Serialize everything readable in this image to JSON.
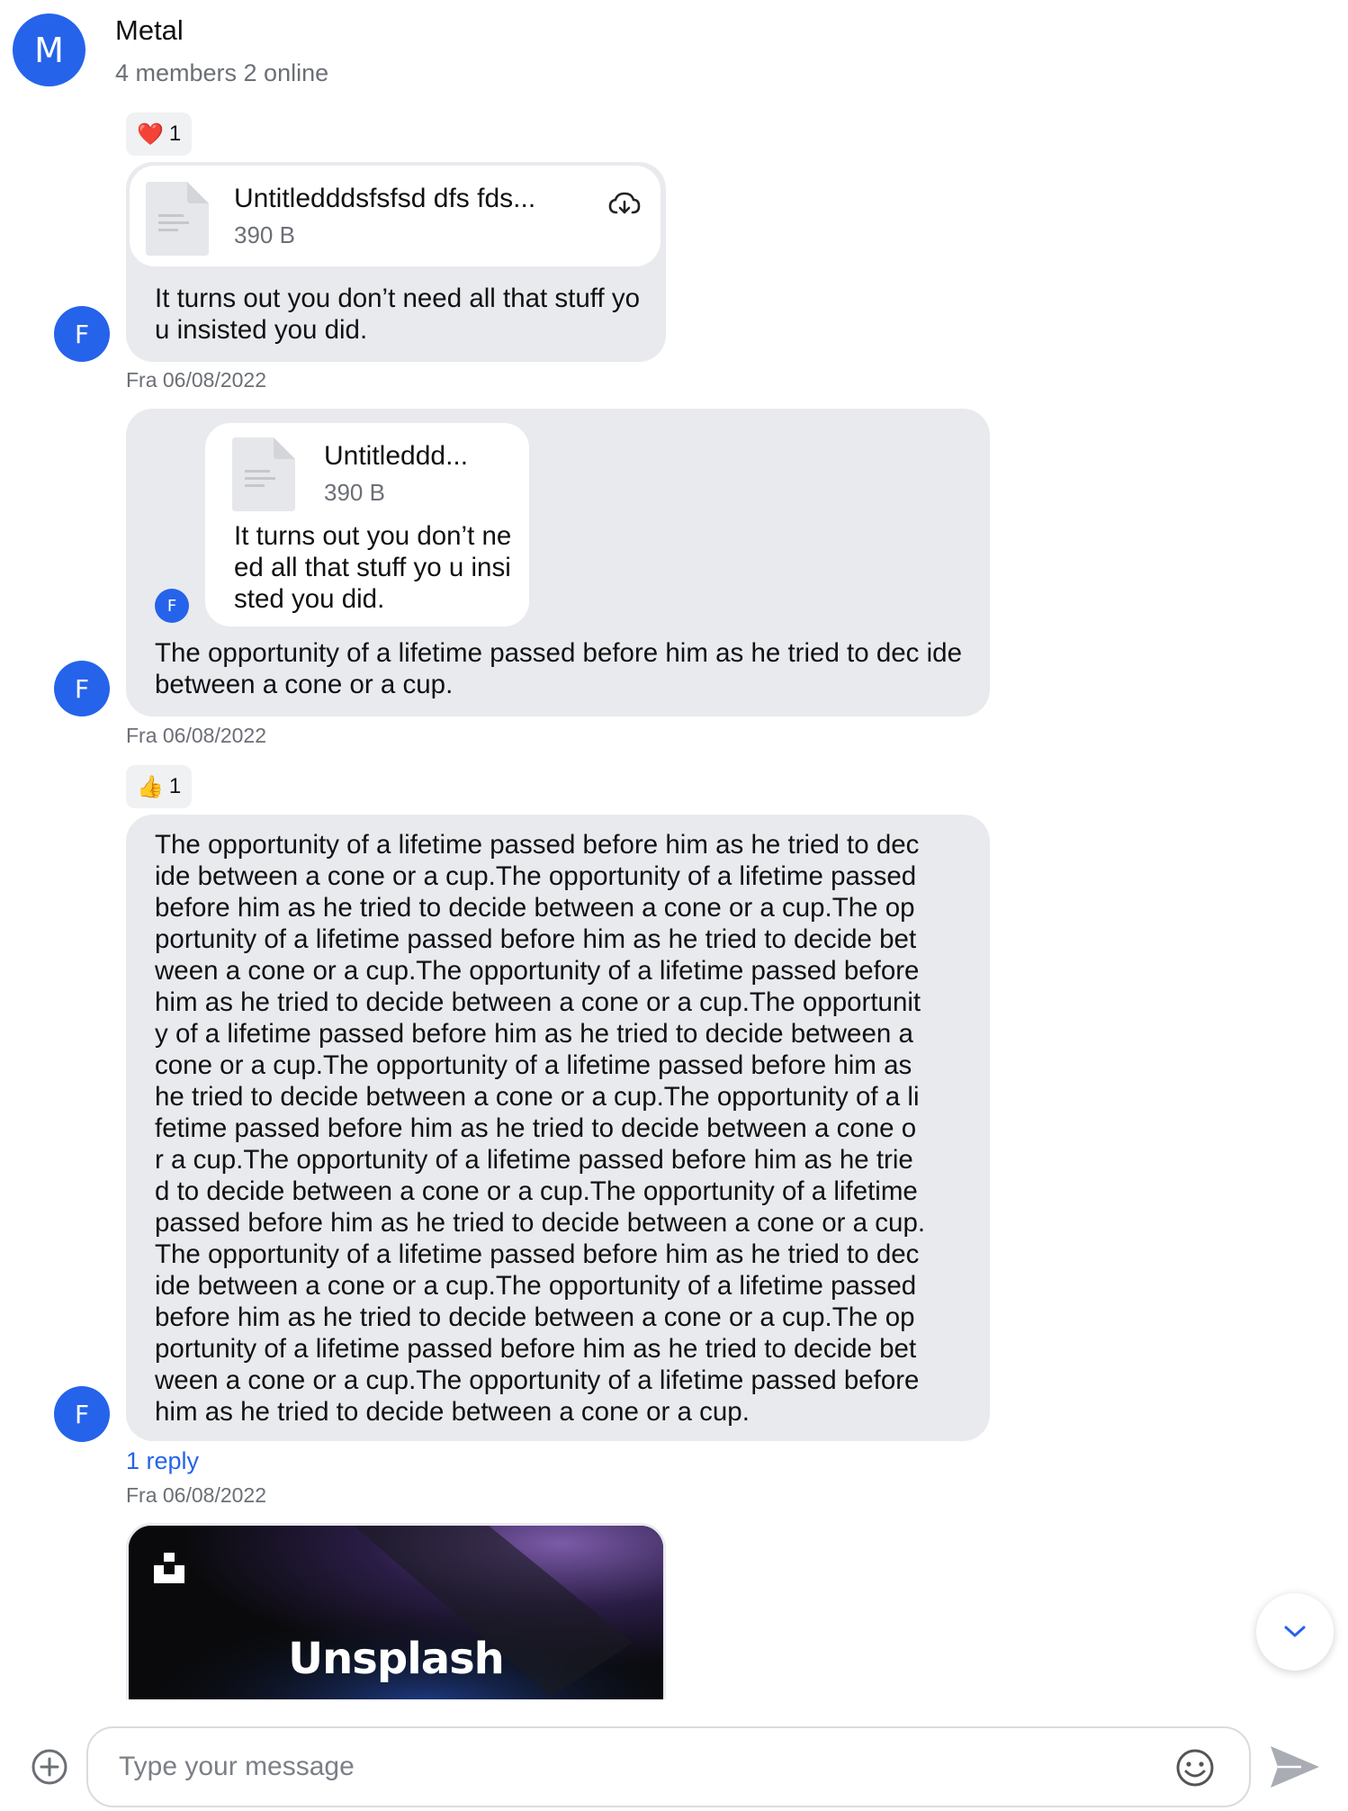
{
  "header": {
    "avatar_initial": "M",
    "title": "Metal",
    "subtitle": "4 members 2 online"
  },
  "messages": [
    {
      "sender_initial": "F",
      "reaction": {
        "emoji": "❤️",
        "count": "1"
      },
      "file": {
        "name": "Untitledddsfsfsd dfs fds...",
        "size": "390 B"
      },
      "text": "It turns out you don’t need all that stuff you insisted you did.",
      "timestamp": "Fra 06/08/2022"
    },
    {
      "sender_initial": "F",
      "quoted": {
        "sender_initial": "F",
        "file": {
          "name": "Untitleddd...",
          "size": "390 B"
        },
        "text": "It turns out you don’t need all that stuff yo u insisted you did."
      },
      "text": "The opportunity of a lifetime passed before him as he tried to dec ide between a cone or a cup.",
      "timestamp": "Fra 06/08/2022"
    },
    {
      "sender_initial": "F",
      "reaction": {
        "emoji": "👍",
        "count": "1"
      },
      "text": "The opportunity of a lifetime passed before him as he tried to dec ide between a cone or a cup.The opportunity of a lifetime passed before him as he tried to decide between a cone or a cup.The op portunity of a lifetime passed before him as he tried to decide bet ween a cone or a cup.The opportunity of a lifetime passed before him as he tried to decide between a cone or a cup.The opportunit y of a lifetime passed before him as he tried to decide between a cone or a cup.The opportunity of a lifetime passed before him as he tried to decide between a cone or a cup.The opportunity of a li fetime passed before him as he tried to decide between a cone o r a cup.The opportunity of a lifetime passed before him as he trie d to decide between a cone or a cup.The opportunity of a lifetime passed before him as he tried to decide between a cone or a cup. The opportunity of a lifetime passed before him as he tried to dec ide between a cone or a cup.The opportunity of a lifetime passed before him as he tried to decide between a cone or a cup.The op portunity of a lifetime passed before him as he tried to decide bet ween a cone or a cup.The opportunity of a lifetime passed before him as he tried to decide between a cone or a cup.",
      "text_lines": [
        "The opportunity of a lifetime passed before him as he tried to dec",
        "ide between a cone or a cup.The opportunity of a lifetime passed",
        "before him as he tried to decide between a cone or a cup.The op",
        "portunity of a lifetime passed before him as he tried to decide bet",
        "ween a cone or a cup.The opportunity of a lifetime passed before",
        "him as he tried to decide between a cone or a cup.The opportunit",
        "y of a lifetime passed before him as he tried to decide between a",
        "cone or a cup.The opportunity of a lifetime passed before him as",
        "he tried to decide between a cone or a cup.The opportunity of a li",
        "fetime passed before him as he tried to decide between a cone o",
        "r a cup.The opportunity of a lifetime passed before him as he trie",
        "d to decide between a cone or a cup.The opportunity of a lifetime",
        "passed before him as he tried to decide between a cone or a cup.",
        "The opportunity of a lifetime passed before him as he tried to dec",
        "ide between a cone or a cup.The opportunity of a lifetime passed",
        "before him as he tried to decide between a cone or a cup.The op",
        "portunity of a lifetime passed before him as he tried to decide bet",
        "ween a cone or a cup.The opportunity of a lifetime passed before",
        "him as he tried to decide between a cone or a cup."
      ],
      "reply_link": "1 reply",
      "timestamp": "Fra 06/08/2022"
    },
    {
      "image_card": {
        "brand": "Unsplash"
      }
    }
  ],
  "composer": {
    "placeholder": "Type your message"
  },
  "icons": {
    "add": "plus-circle-icon",
    "emoji": "smiley-icon",
    "send": "send-icon",
    "scroll_down": "chevron-down-icon",
    "download": "cloud-download-icon",
    "file": "file-icon"
  },
  "colors": {
    "accent": "#2563eb",
    "bubble": "#e9eaee",
    "muted_text": "#6b6f76"
  }
}
